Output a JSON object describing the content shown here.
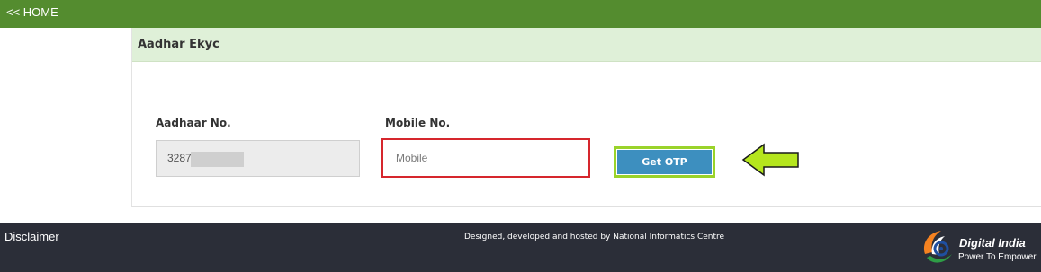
{
  "nav": {
    "home_label": "<< HOME"
  },
  "panel": {
    "title": "Aadhar Ekyc"
  },
  "form": {
    "aadhaar": {
      "label": "Aadhaar No.",
      "value": "3287"
    },
    "mobile": {
      "label": "Mobile No.",
      "placeholder": "Mobile",
      "value": ""
    },
    "otp_button_label": "Get OTP"
  },
  "footer": {
    "disclaimer_label": "Disclaimer",
    "credit": "Designed, developed and hosted by National Informatics Centre",
    "logo_title": "Digital India",
    "logo_tagline": "Power To Empower"
  },
  "icons": {
    "pointer_arrow": "arrow-left-icon",
    "logo": "digital-india-logo-icon"
  },
  "colors": {
    "topbar": "#548c2f",
    "panel_header": "#dff0d8",
    "mobile_border": "#d6262d",
    "otp_button": "#3d8fbf",
    "otp_highlight": "#9ad32a",
    "arrow": "#b5e61d",
    "footer": "#2b2e38"
  }
}
